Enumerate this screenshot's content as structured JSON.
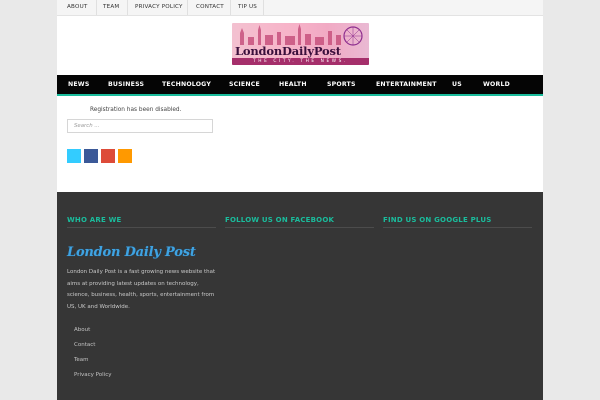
{
  "top_nav": {
    "items": [
      "ABOUT",
      "TEAM",
      "PRIVACY POLICY",
      "CONTACT",
      "TIP US"
    ]
  },
  "logo": {
    "title": "LondonDailyPost",
    "tagline": "THE CITY. THE NEWS."
  },
  "main_nav": {
    "items": [
      "NEWS",
      "BUSINESS",
      "TECHNOLOGY",
      "SCIENCE",
      "HEALTH",
      "SPORTS",
      "ENTERTAINMENT",
      "US",
      "WORLD"
    ]
  },
  "content": {
    "notice": "Registration has been disabled.",
    "search_placeholder": "Search ..."
  },
  "social": [
    {
      "icon": "twitter-icon",
      "color": "#33ccff"
    },
    {
      "icon": "facebook-icon",
      "color": "#3b5998"
    },
    {
      "icon": "google-plus-icon",
      "color": "#dd4b39"
    },
    {
      "icon": "rss-icon",
      "color": "#ff9900"
    }
  ],
  "footer": {
    "who_heading": "WHO ARE WE",
    "facebook_heading": "FOLLOW US ON FACEBOOK",
    "google_heading": "FIND US ON GOOGLE PLUS",
    "logo_text": "London Daily Post",
    "description": "London Daily Post is a fast growing news website that aims at providing latest updates on technology, science, business, health, sports, entertainment from US, UK and Worldwide.",
    "links": [
      "About",
      "Contact",
      "Team",
      "Privacy Policy"
    ]
  },
  "colors": {
    "accent": "#1abc9c",
    "nav_bg": "#050505",
    "footer_bg": "#363636"
  }
}
